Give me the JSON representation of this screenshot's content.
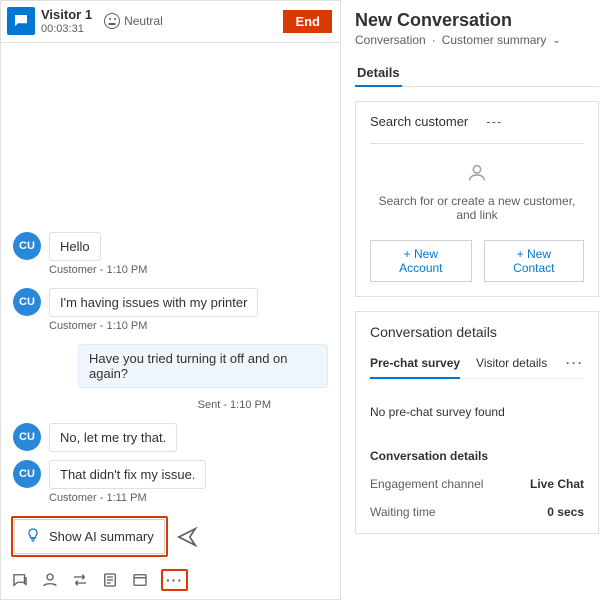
{
  "header": {
    "visitor_name": "Visitor 1",
    "timer": "00:03:31",
    "sentiment": "Neutral",
    "end_label": "End"
  },
  "messages": [
    {
      "who": "customer",
      "text": "Hello",
      "meta": "Customer - 1:10 PM"
    },
    {
      "who": "customer",
      "text": "I'm having issues with my printer",
      "meta": "Customer - 1:10 PM"
    },
    {
      "who": "agent",
      "text": "Have you tried turning it off and on again?",
      "meta": "Sent - 1:10 PM"
    },
    {
      "who": "customer",
      "text": "No, let me try that.",
      "meta": ""
    },
    {
      "who": "customer",
      "text": "That didn't fix my issue.",
      "meta": "Customer - 1:11 PM"
    }
  ],
  "compose": {
    "ai_summary_label": "Show AI summary"
  },
  "right": {
    "title": "New Conversation",
    "breadcrumb_a": "Conversation",
    "breadcrumb_b": "Customer summary",
    "details_tab": "Details",
    "search_customer_label": "Search customer",
    "search_customer_value": "---",
    "cust_help": "Search for or create a new customer, and link",
    "new_account": "+ New Account",
    "new_contact": "+ New Contact",
    "conv_details_title": "Conversation details",
    "inner_tab_a": "Pre-chat survey",
    "inner_tab_b": "Visitor details",
    "no_survey": "No pre-chat survey found",
    "conv_details_sub": "Conversation details",
    "kv": [
      {
        "k": "Engagement channel",
        "v": "Live Chat"
      },
      {
        "k": "Waiting time",
        "v": "0 secs"
      }
    ]
  }
}
